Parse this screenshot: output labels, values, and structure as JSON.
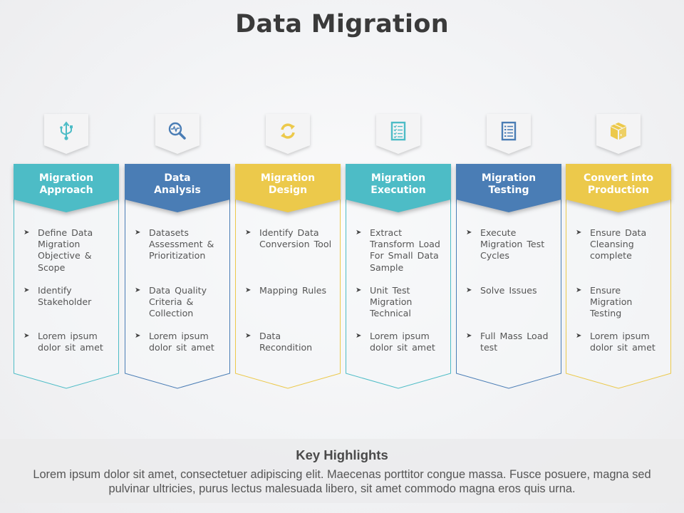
{
  "title": "Data Migration",
  "colors": {
    "teal": "#4dbcc6",
    "blue": "#4a7db5",
    "yellow": "#ecc94b",
    "title_text": "#3a3a3a",
    "body_text": "#555555"
  },
  "steps": [
    {
      "title_line1": "Migration",
      "title_line2": "Approach",
      "color": "#4dbcc6",
      "icon": "usb-icon",
      "items": [
        "Define Data Migration Objective & Scope",
        "Identify Stakeholder",
        "Lorem ipsum dolor sit amet"
      ]
    },
    {
      "title_line1": "Data",
      "title_line2": "Analysis",
      "color": "#4a7db5",
      "icon": "magnifier-pulse-icon",
      "items": [
        "Datasets Assessment & Prioritization",
        "Data Quality Criteria & Collection",
        "Lorem ipsum dolor sit amet"
      ]
    },
    {
      "title_line1": "Migration",
      "title_line2": "Design",
      "color": "#ecc94b",
      "icon": "sync-icon",
      "items": [
        "Identify Data Conversion Tool",
        "Mapping Rules",
        "Data Recondition"
      ]
    },
    {
      "title_line1": "Migration",
      "title_line2": "Execution",
      "color": "#4dbcc6",
      "icon": "checklist-icon",
      "items": [
        "Extract Transform Load For Small Data Sample",
        "Unit Test Migration Technical",
        "Lorem ipsum dolor sit amet"
      ]
    },
    {
      "title_line1": "Migration",
      "title_line2": "Testing",
      "color": "#4a7db5",
      "icon": "list-icon",
      "items": [
        "Execute Migration Test Cycles",
        "Solve Issues",
        "Full Mass Load test"
      ]
    },
    {
      "title_line1": "Convert into",
      "title_line2": "Production",
      "color": "#ecc94b",
      "icon": "package-box-icon",
      "items": [
        "Ensure Data Cleansing complete",
        "Ensure Migration Testing",
        "Lorem ipsum dolor sit amet"
      ]
    }
  ],
  "bullet_glyph": "➤",
  "highlights": {
    "title": "Key Highlights",
    "body": "Lorem ipsum dolor sit amet, consectetuer adipiscing elit. Maecenas porttitor congue massa. Fusce posuere, magna sed pulvinar ultricies, purus lectus malesuada libero, sit amet commodo magna eros quis urna."
  }
}
